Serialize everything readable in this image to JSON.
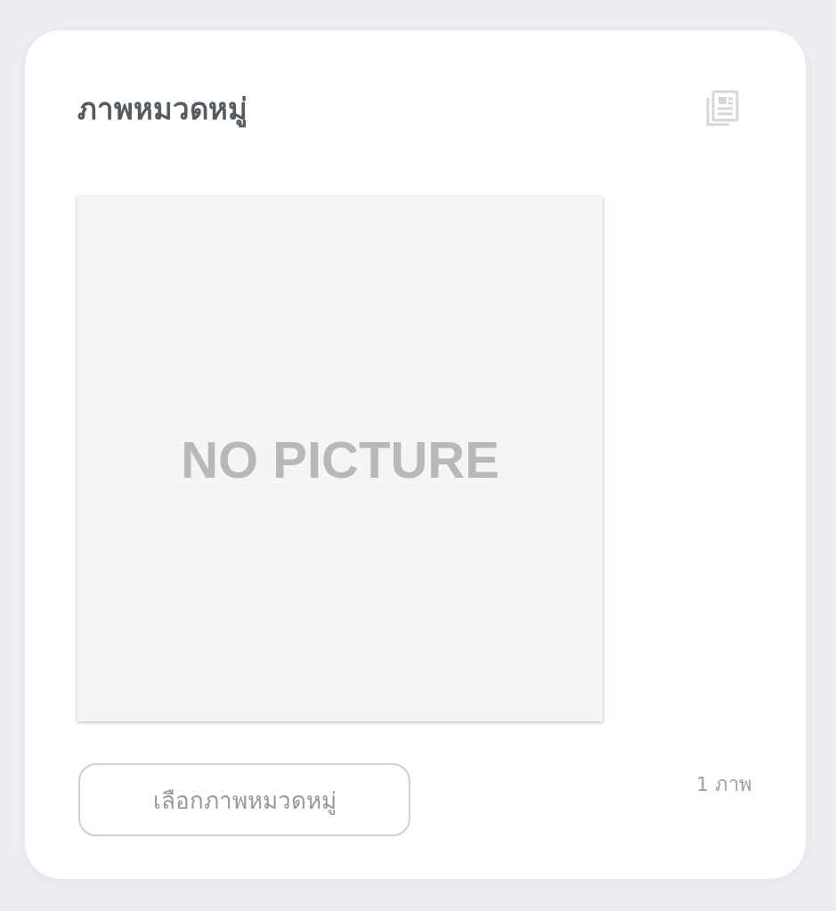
{
  "card": {
    "title": "ภาพหมวดหมู่",
    "image": {
      "placeholder_text": "NO PICTURE"
    },
    "button": "เลือกภาพหมวดหมู่",
    "count": "1 ภาพ"
  }
}
